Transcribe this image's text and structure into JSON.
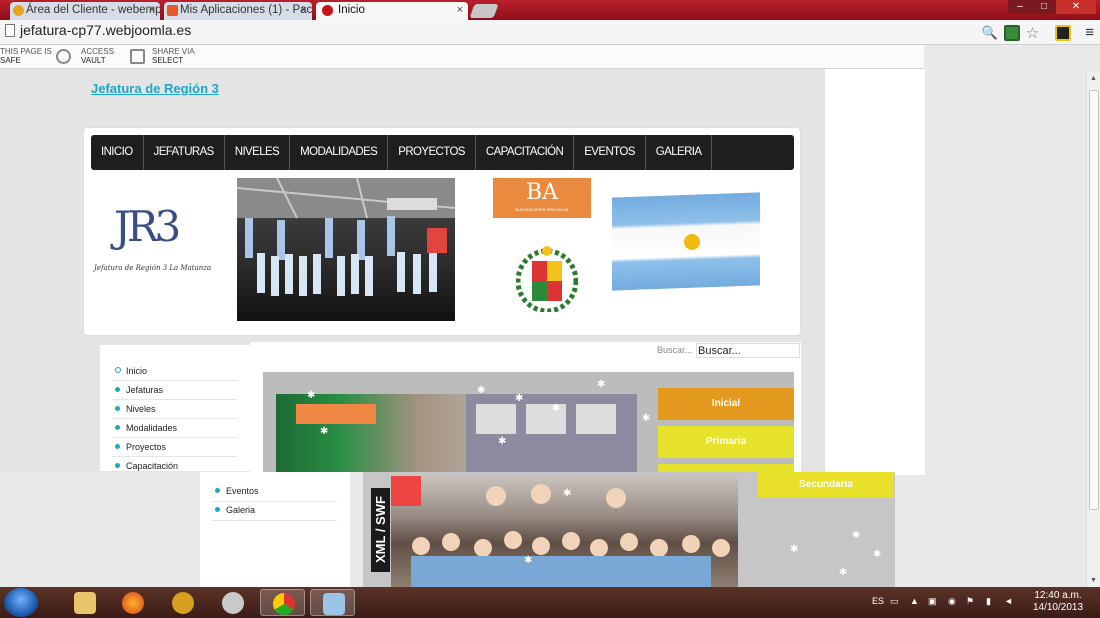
{
  "browser": {
    "tabs": [
      {
        "title": "Área del Cliente - webemp",
        "favicon_color": "#e8a21b"
      },
      {
        "title": "Mis Aplicaciones (1) - Pac",
        "favicon_color": "#e2592a"
      },
      {
        "title": "Inicio",
        "favicon_color": "#c7151d",
        "active": true
      }
    ],
    "close_glyph": "×",
    "url": "jefatura-cp77.webjoomla.es",
    "window_buttons": [
      "–",
      "□",
      "✕"
    ]
  },
  "norton_toolbar": {
    "safe": {
      "caption": "THIS PAGE IS",
      "value": "SAFE"
    },
    "vault": {
      "caption": "ACCESS",
      "value": "VAULT"
    },
    "share": {
      "caption": "SHARE VIA",
      "value": "SELECT"
    }
  },
  "site": {
    "title": "Jefatura de Región 3",
    "nav": [
      "INICIO",
      "JEFATURAS",
      "NIVELES",
      "MODALIDADES",
      "PROYECTOS",
      "CAPACITACIÓN",
      "EVENTOS",
      "GALERIA"
    ],
    "logo": {
      "letters": "JR3",
      "caption": "Jefatura de Región 3 La Matanza"
    },
    "ba_logo": {
      "letters": "BA",
      "caption": "BUENOS AIRES PROVINCIA"
    },
    "search": {
      "label": "Buscar...",
      "value": "Buscar..."
    },
    "side_menu": [
      "Inicio",
      "Jefaturas",
      "Niveles",
      "Modalidades",
      "Proyectos",
      "Capacitación"
    ],
    "levels": [
      "Inicial",
      "Primaria",
      "Secundaria"
    ],
    "slider_badge": "XML / SWF",
    "under_menu": [
      "Eventos",
      "Galeria"
    ],
    "accent_color": "#1ba7c8"
  },
  "taskbar": {
    "language": "ES",
    "time": "12:40 a.m.",
    "date": "14/10/2013"
  }
}
